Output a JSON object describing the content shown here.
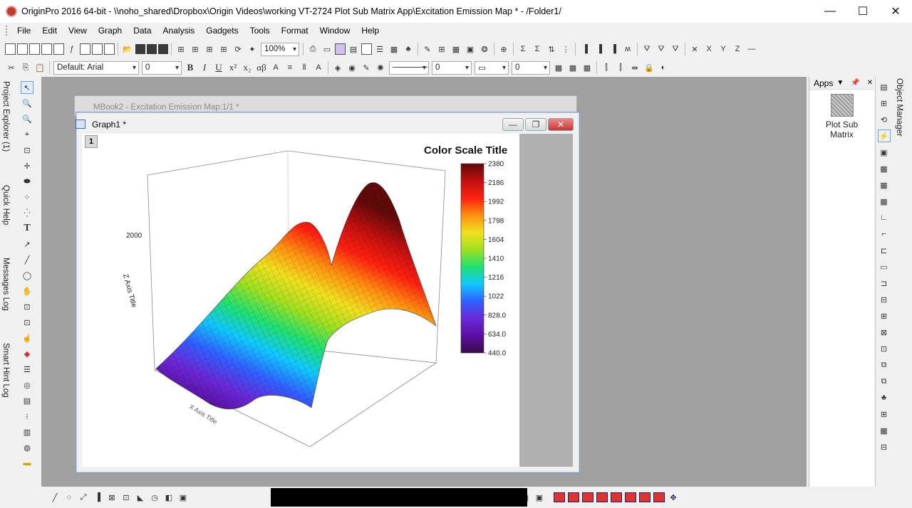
{
  "window": {
    "title": "OriginPro 2016 64-bit - \\\\noho_shared\\Dropbox\\Origin Videos\\working VT-2724 Plot Sub Matrix App\\Excitation Emission Map * - /Folder1/",
    "min": "—",
    "max": "☐",
    "close": "✕"
  },
  "menu": [
    "File",
    "Edit",
    "View",
    "Graph",
    "Data",
    "Analysis",
    "Gadgets",
    "Tools",
    "Format",
    "Window",
    "Help"
  ],
  "toolbar": {
    "zoom": "100%",
    "font": "Default: Arial",
    "font_size": "0",
    "line_width": "0",
    "border_size": "0",
    "bold": "B",
    "italic": "I",
    "underline": "U",
    "superscript": "x²",
    "subscript": "x₂",
    "greek": "αβ",
    "xyz_labels": [
      "X",
      "Y",
      "Z"
    ]
  },
  "side_tabs": {
    "project_explorer": "Project Explorer (1)",
    "quick_help": "Quick Help",
    "messages_log": "Messages Log",
    "smart_hint_log": "Smart Hint Log",
    "object_manager": "Object Manager"
  },
  "back_window": {
    "title": "MBook2 - Excitation Emission Map:1/1 *"
  },
  "graph_window": {
    "title": "Graph1 *",
    "layer": "1",
    "min": "—",
    "restore": "❐",
    "close": "✕"
  },
  "apps": {
    "header": "Apps",
    "item": "Plot Sub Matrix"
  },
  "chart_data": {
    "type": "surface-3d",
    "colorbar_title": "Color Scale Title",
    "colorbar_ticks": [
      "2380",
      "2186",
      "1992",
      "1798",
      "1604",
      "1410",
      "1216",
      "1022",
      "828.0",
      "634.0",
      "440.0"
    ],
    "colorbar_range": [
      440,
      2380
    ],
    "colormap": [
      "#3a0a4a",
      "#5a10a0",
      "#6a28d8",
      "#3060ff",
      "#10c8ff",
      "#20e070",
      "#a0e020",
      "#f0e020",
      "#ff9010",
      "#ff2010",
      "#c01010",
      "#600a0a"
    ],
    "zlabel": "Z Axis Title",
    "xlabel": "X Axis Title",
    "z_tick": "2000"
  }
}
